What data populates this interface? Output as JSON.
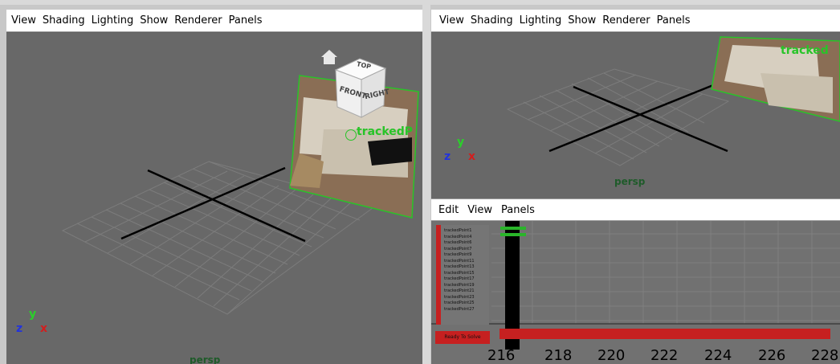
{
  "left_panel": {
    "menu": [
      "View",
      "Shading",
      "Lighting",
      "Show",
      "Renderer",
      "Panels"
    ],
    "camera_label": "persp",
    "viewcube": {
      "top": "TOP",
      "front": "FRONT",
      "right": "RIGHT"
    },
    "object_label": "trackedP",
    "axis": {
      "x": "x",
      "y": "y",
      "z": "z"
    }
  },
  "right_top_panel": {
    "menu": [
      "View",
      "Shading",
      "Lighting",
      "Show",
      "Renderer",
      "Panels"
    ],
    "camera_label": "persp",
    "object_label": "tracked",
    "axis": {
      "x": "x",
      "y": "y",
      "z": "z"
    }
  },
  "graph_editor": {
    "menu": [
      "Edit",
      "View",
      "Panels"
    ],
    "items": [
      "trackedPoint1",
      "trackedPoint4",
      "trackedPoint6",
      "trackedPoint7",
      "trackedPoint9",
      "trackedPoint11",
      "trackedPoint13",
      "trackedPoint15",
      "trackedPoint17",
      "trackedPoint19",
      "trackedPoint21",
      "trackedPoint23",
      "trackedPoint25",
      "trackedPoint27"
    ],
    "status_label": "Ready To Solve",
    "frame_ticks": [
      "216",
      "218",
      "220",
      "222",
      "224",
      "226",
      "228"
    ]
  },
  "colors": {
    "viewport_bg": "#686868",
    "grid": "#7c7c7c",
    "axis_line": "#000000",
    "object_green": "#28c428",
    "axis_x": "#d21e1e",
    "axis_y": "#2ad02a",
    "axis_z": "#2233dd",
    "status_red": "#c62020"
  }
}
